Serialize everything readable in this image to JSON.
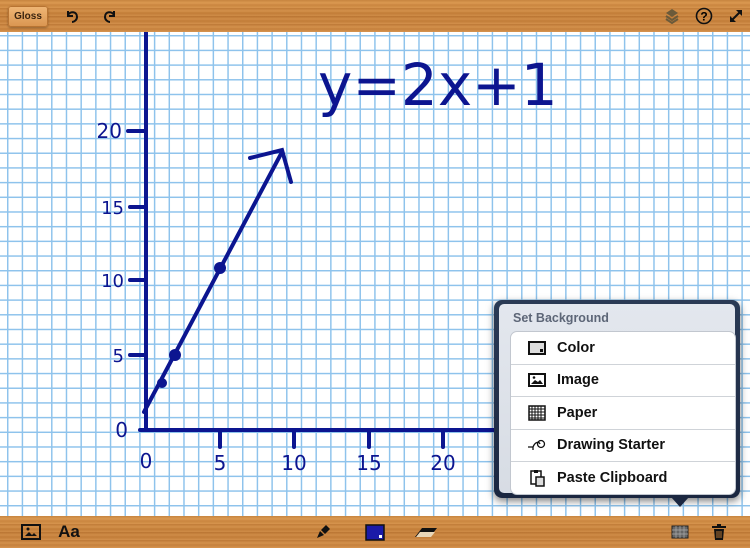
{
  "toolbar_top": {
    "gloss_label": "Gloss",
    "icons": [
      "undo-icon",
      "redo-icon",
      "layers-icon",
      "help-icon",
      "expand-icon"
    ]
  },
  "drawing": {
    "equation": "y=2x+1",
    "y_tick_labels": [
      "20",
      "15",
      "10",
      "5",
      "0"
    ],
    "x_tick_labels": [
      "0",
      "5",
      "10",
      "15",
      "20"
    ],
    "ink_color": "#0c1590"
  },
  "popover": {
    "title": "Set Background",
    "items": [
      {
        "label": "Color",
        "icon": "color-icon"
      },
      {
        "label": "Image",
        "icon": "image-icon"
      },
      {
        "label": "Paper",
        "icon": "paper-grid-icon"
      },
      {
        "label": "Drawing Starter",
        "icon": "drawing-starter-icon"
      },
      {
        "label": "Paste Clipboard",
        "icon": "clipboard-icon"
      }
    ]
  },
  "toolbar_bottom": {
    "text_tool_label": "Aa",
    "pen_color": "#1a1aa8",
    "icons": [
      "insert-image-icon",
      "pen-icon",
      "color-swatch-icon",
      "eraser-icon",
      "background-icon",
      "trash-icon"
    ]
  }
}
